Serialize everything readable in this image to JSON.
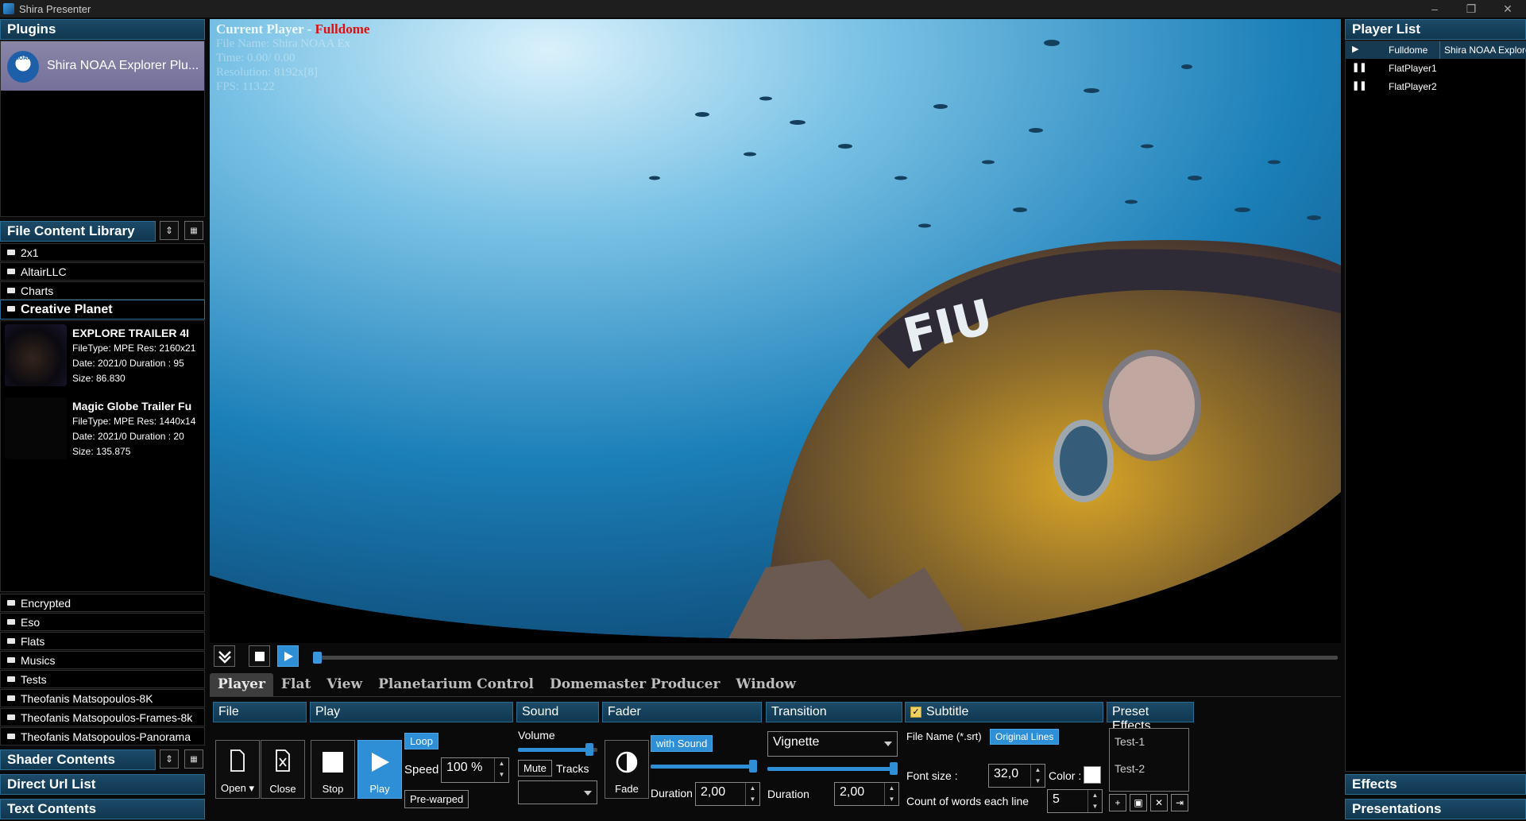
{
  "window": {
    "title": "Shira Presenter"
  },
  "plugins": {
    "header": "Plugins",
    "items": [
      {
        "label": "Shira NOAA Explorer Plu...",
        "logo_text": "NOAA"
      }
    ]
  },
  "library": {
    "header": "File Content Library",
    "folders_top": [
      "2x1",
      "AltairLLC",
      "Charts"
    ],
    "open_folder": "Creative Planet",
    "files": [
      {
        "title": "EXPLORE TRAILER 4I",
        "line1": "FileType: MPE Res: 2160x21",
        "line2": "Date: 2021/0 Duration : 95",
        "line3": "Size: 86.830"
      },
      {
        "title": "Magic Globe Trailer Fu",
        "line1": "FileType: MPE Res: 1440x14",
        "line2": "Date: 2021/0 Duration : 20",
        "line3": "Size: 135.875"
      }
    ],
    "folders_bottom": [
      "Encrypted",
      "Eso",
      "Flats",
      "Musics",
      "Tests",
      "Theofanis Matsopoulos-8K",
      "Theofanis Matsopoulos-Frames-8k",
      "Theofanis Matsopoulos-Panorama"
    ]
  },
  "sidebar_sections": {
    "shader": "Shader Contents",
    "direct_url": "Direct Url List",
    "text": "Text Contents"
  },
  "viewport": {
    "current_player_label": "Current Player -",
    "current_player_value": "Fulldome",
    "file_name": "File Name: Shira NOAA Ex",
    "time": "Time: 0.00/ 0.00",
    "resolution": "Resolution: 8192x[8]",
    "fps": "FPS: 113.22",
    "hull_text": "FIU"
  },
  "transport": {
    "progress": 0.0
  },
  "menu": {
    "tabs": [
      "Player",
      "Flat",
      "View",
      "Planetarium Control",
      "Domemaster Producer",
      "Window"
    ],
    "active": "Player"
  },
  "controls": {
    "file": {
      "header": "File",
      "open": "Open",
      "close": "Close"
    },
    "play": {
      "header": "Play",
      "stop": "Stop",
      "play": "Play",
      "loop": "Loop",
      "speed_label": "Speed",
      "speed_value": "100 %",
      "prewarped": "Pre-warped"
    },
    "sound": {
      "header": "Sound",
      "volume_label": "Volume",
      "volume_level": 0.95,
      "mute": "Mute",
      "tracks": "Tracks"
    },
    "fader": {
      "header": "Fader",
      "fade": "Fade",
      "with_sound": "with Sound",
      "duration_label": "Duration",
      "duration_value": "2,00",
      "level": 1.0
    },
    "transition": {
      "header": "Transition",
      "effect": "Vignette",
      "duration_label": "Duration",
      "duration_value": "2,00",
      "level": 1.0
    },
    "subtitle": {
      "header": "Subtitle",
      "file_name_label": "File Name (*.srt)",
      "original_lines": "Original Lines",
      "font_size_label": "Font size :",
      "font_size_value": "32,0",
      "color_label": "Color :",
      "color": "#ffffff",
      "words_label": "Count of words each line",
      "words_value": "5"
    },
    "presets": {
      "header": "Preset Effects",
      "items": [
        "Test-1",
        "Test-2"
      ]
    }
  },
  "player_list": {
    "header": "Player List",
    "rows": [
      {
        "state": "playing",
        "name": "Fulldome",
        "content": "Shira NOAA Explorer"
      },
      {
        "state": "paused",
        "name": "FlatPlayer1",
        "content": ""
      },
      {
        "state": "paused",
        "name": "FlatPlayer2",
        "content": ""
      }
    ]
  },
  "right_sections": {
    "effects": "Effects",
    "presentations": "Presentations"
  },
  "colors": {
    "accent": "#2f8fd6",
    "header_bg": "#174463",
    "alert": "#e01010"
  }
}
